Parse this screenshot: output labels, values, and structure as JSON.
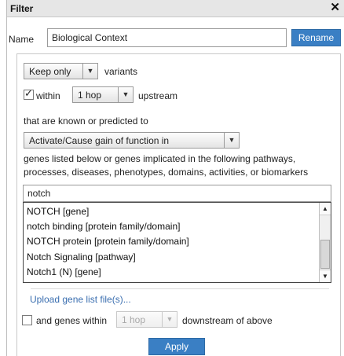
{
  "dialog": {
    "title": "Filter",
    "close_glyph": "✕"
  },
  "name_row": {
    "label": "Name",
    "value": "Biological Context",
    "rename_label": "Rename"
  },
  "keep_row": {
    "selected": "Keep only",
    "suffix": "variants"
  },
  "within_row": {
    "checked": true,
    "label": "within",
    "hop_selected": "1 hop",
    "suffix": "upstream"
  },
  "known_text": "that are known or predicted to",
  "effect_select": "Activate/Cause gain of function in",
  "description_line1": "genes listed below or genes implicated in the following pathways,",
  "description_line2": "processes, diseases, phenotypes, domains, activities, or biomarkers",
  "search": {
    "value": "notch"
  },
  "suggestions": [
    "NOTCH [gene]",
    "notch binding [protein family/domain]",
    "NOTCH protein [protein family/domain]",
    "Notch Signaling [pathway]",
    "Notch1 (N) [gene]"
  ],
  "upload_link": "Upload gene list file(s)...",
  "downstream_row": {
    "checked": false,
    "label": "and genes within",
    "hop_selected": "1 hop",
    "suffix": "downstream of above"
  },
  "apply_label": "Apply",
  "icons": {
    "dropdown_arrow": "▼",
    "scroll_up": "▲",
    "scroll_down": "▼",
    "check": "✓"
  },
  "colors": {
    "accent": "#3a7fc4",
    "link": "#3b6fb0",
    "titlebar": "#e6e6e6"
  }
}
